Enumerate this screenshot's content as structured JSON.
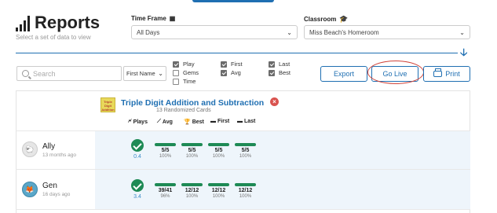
{
  "header": {
    "title": "Reports",
    "subtitle": "Select a set of data to view"
  },
  "filters": {
    "time_frame_label": "Time Frame",
    "time_frame_value": "All Days",
    "classroom_label": "Classroom",
    "classroom_value": "Miss Beach's Homeroom"
  },
  "toolbar": {
    "search_placeholder": "Search",
    "sort_value": "First Name",
    "checkboxes": [
      {
        "label": "Play",
        "checked": true
      },
      {
        "label": "Gems",
        "checked": false
      },
      {
        "label": "Time",
        "checked": false
      },
      {
        "label": "First",
        "checked": true
      },
      {
        "label": "Avg",
        "checked": true
      },
      {
        "label": "Last",
        "checked": true
      },
      {
        "label": "Best",
        "checked": true
      }
    ],
    "export_label": "Export",
    "golive_label": "Go Live",
    "print_label": "Print"
  },
  "activity": {
    "icon_text": "Triple Digit Addition",
    "title": "Triple Digit Addition and Subtraction",
    "subtitle": "13 Randomized Cards",
    "columns": [
      "Plays",
      "Avg",
      "Best",
      "First",
      "Last"
    ]
  },
  "students": [
    {
      "name": "Ally",
      "last_seen": "13 months ago",
      "plays": "0.4",
      "stats": [
        {
          "score": "5/5",
          "pct": "100%"
        },
        {
          "score": "5/5",
          "pct": "100%"
        },
        {
          "score": "5/5",
          "pct": "100%"
        },
        {
          "score": "5/5",
          "pct": "100%"
        }
      ]
    },
    {
      "name": "Gen",
      "last_seen": "16 days ago",
      "plays": "3.4",
      "stats": [
        {
          "score": "39/41",
          "pct": "96%"
        },
        {
          "score": "12/12",
          "pct": "100%"
        },
        {
          "score": "12/12",
          "pct": "100%"
        },
        {
          "score": "12/12",
          "pct": "100%"
        }
      ]
    }
  ],
  "colors": {
    "accent": "#1f6fb2",
    "success": "#1e8a55",
    "danger": "#d9534f",
    "row_band": "#eef5fb"
  },
  "icons": {
    "reports": "bar-chart-icon",
    "calendar": "calendar-icon",
    "classroom": "graduation-cap-icon",
    "down": "arrow-down-icon",
    "search": "search-icon",
    "print": "printer-icon",
    "remove": "close-icon"
  }
}
